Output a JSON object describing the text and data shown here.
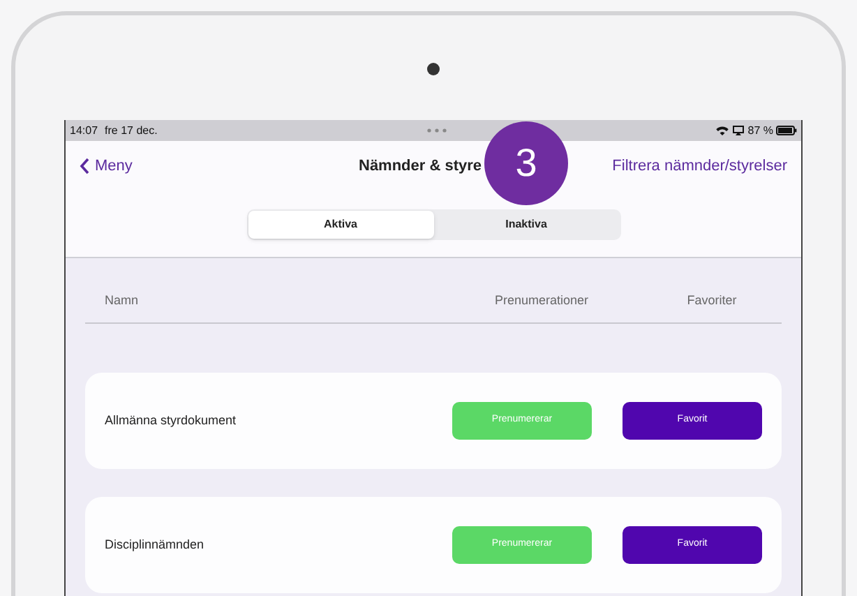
{
  "status_bar": {
    "time": "14:07",
    "date": "fre 17 dec.",
    "battery": "87 %"
  },
  "nav": {
    "back": "Meny",
    "title": "Nämnder & styre",
    "action": "Filtrera nämnder/styrelser"
  },
  "step_badge": "3",
  "tabs": [
    {
      "label": "Aktiva",
      "selected": true
    },
    {
      "label": "Inaktiva",
      "selected": false
    }
  ],
  "columns": [
    "Namn",
    "Prenumerationer",
    "Favoriter"
  ],
  "rows": [
    {
      "name": "Allmänna styrdokument",
      "subscribe": "Prenumererar",
      "favorite": "Favorit"
    },
    {
      "name": "Disciplinnämnden",
      "subscribe": "Prenumererar",
      "favorite": "Favorit"
    }
  ]
}
